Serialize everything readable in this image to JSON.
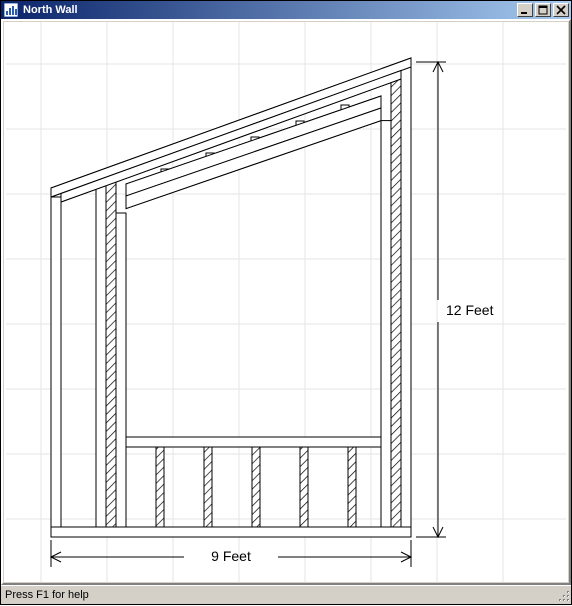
{
  "window": {
    "title": "North Wall",
    "icon_name": "barchart-icon"
  },
  "titlebar_buttons": {
    "minimize_tip": "Minimize",
    "maximize_tip": "Maximize",
    "close_tip": "Close"
  },
  "statusbar": {
    "help_text": "Press F1 for help"
  },
  "diagram": {
    "width_label": "9 Feet",
    "height_label": "12 Feet",
    "colors": {
      "grid": "#e5e5e5",
      "ink": "#000000",
      "bg": "#ffffff"
    },
    "wall": {
      "width_ft": 9,
      "height_right_ft": 12,
      "height_left_ft_approx": 9,
      "opening": "large central rough opening with header and sill, cripple studs above and below",
      "stud_pattern": "king/jack studs at opening edges plus end studs; sloped double top plate, single bottom plate"
    }
  }
}
